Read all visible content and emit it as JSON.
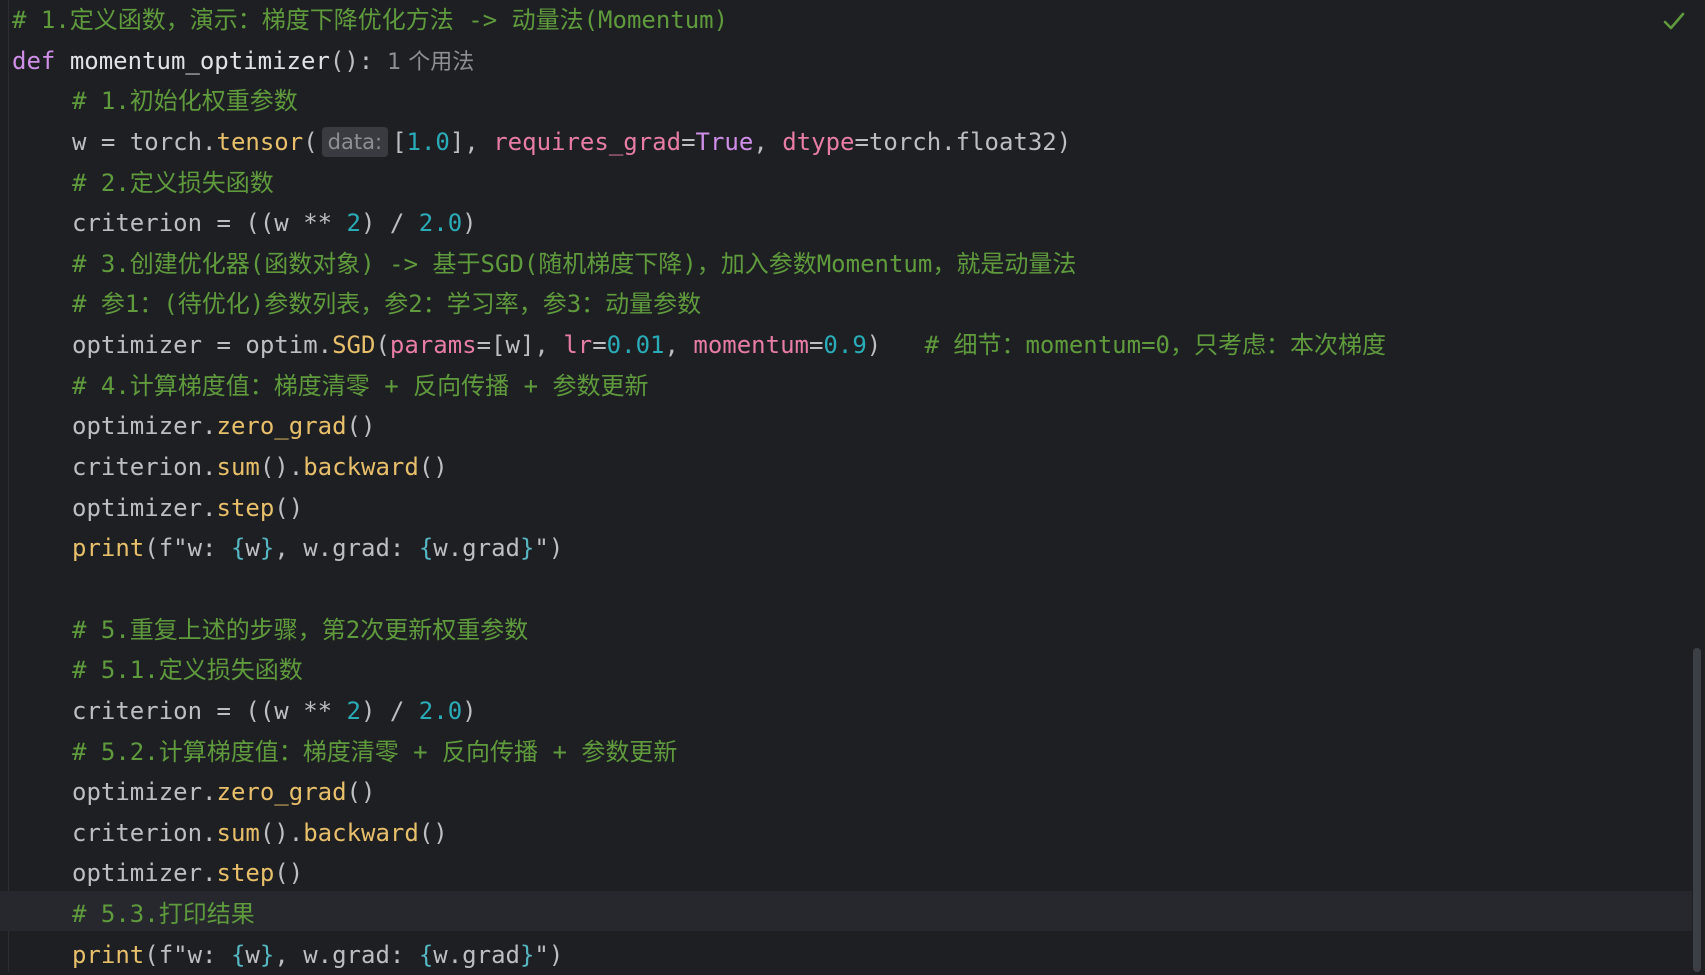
{
  "editor": {
    "status": "no-problems-check-icon",
    "usage_hint": "1 个用法",
    "inlay_hint": "data:",
    "lines": {
      "l1": "# 1.定义函数，演示：梯度下降优化方法 -> 动量法(Momentum)",
      "l2_kw": "def",
      "l2_name": "momentum_optimizer",
      "l2_rest": "():",
      "l3": "# 1.初始化权重参数",
      "l4_a": "w = torch.",
      "l4_fn": "tensor",
      "l4_b": "(",
      "l4_c": "[",
      "l4_num": "1.0",
      "l4_d": "], ",
      "l4_p1": "requires_grad",
      "l4_e": "=",
      "l4_true": "True",
      "l4_f": ", ",
      "l4_p2": "dtype",
      "l4_g": "=torch.float32)",
      "l5": "# 2.定义损失函数",
      "l6_a": "criterion = ((w ** ",
      "l6_n1": "2",
      "l6_b": ") / ",
      "l6_n2": "2.0",
      "l6_c": ")",
      "l7": "# 3.创建优化器(函数对象) -> 基于SGD(随机梯度下降)，加入参数Momentum，就是动量法",
      "l8": "# 参1：(待优化)参数列表，参2：学习率，参3：动量参数",
      "l9_a": "optimizer = optim.",
      "l9_fn": "SGD",
      "l9_b": "(",
      "l9_p1": "params",
      "l9_c": "=[w], ",
      "l9_p2": "lr",
      "l9_d": "=",
      "l9_n1": "0.01",
      "l9_e": ", ",
      "l9_p3": "momentum",
      "l9_f": "=",
      "l9_n2": "0.9",
      "l9_g": ")   ",
      "l9_comment": "# 细节：momentum=0，只考虑：本次梯度",
      "l10": "# 4.计算梯度值：梯度清零 + 反向传播 + 参数更新",
      "l11_a": "optimizer.",
      "l11_fn": "zero_grad",
      "l11_b": "()",
      "l12_a": "criterion.",
      "l12_fn1": "sum",
      "l12_b": "().",
      "l12_fn2": "backward",
      "l12_c": "()",
      "l13_a": "optimizer.",
      "l13_fn": "step",
      "l13_b": "()",
      "l14_fn": "print",
      "l14_a": "(f\"w: ",
      "l14_b1": "{",
      "l14_v1": "w",
      "l14_b2": "}",
      "l14_b": ", w.grad: ",
      "l14_b3": "{",
      "l14_v2": "w.grad",
      "l14_b4": "}",
      "l14_c": "\")",
      "l16": "# 5.重复上述的步骤，第2次更新权重参数",
      "l17": "# 5.1.定义损失函数",
      "l18_a": "criterion = ((w ** ",
      "l18_n1": "2",
      "l18_b": ") / ",
      "l18_n2": "2.0",
      "l18_c": ")",
      "l19": "# 5.2.计算梯度值：梯度清零 + 反向传播 + 参数更新",
      "l20_a": "optimizer.",
      "l20_fn": "zero_grad",
      "l20_b": "()",
      "l21_a": "criterion.",
      "l21_fn1": "sum",
      "l21_b": "().",
      "l21_fn2": "backward",
      "l21_c": "()",
      "l22_a": "optimizer.",
      "l22_fn": "step",
      "l22_b": "()",
      "l23": "# 5.3.打印结果",
      "l24_fn": "print",
      "l24_a": "(f\"w: ",
      "l24_b1": "{",
      "l24_v1": "w",
      "l24_b2": "}",
      "l24_b": ", w.grad: ",
      "l24_b3": "{",
      "l24_v2": "w.grad",
      "l24_b4": "}",
      "l24_c": "\")"
    }
  },
  "colors": {
    "background": "#1e1f22",
    "comment": "#5f9b3d",
    "keyword": "#cf8ee8",
    "number": "#2aacb8",
    "method": "#e8bf6a",
    "parameter": "#e77ca6"
  }
}
